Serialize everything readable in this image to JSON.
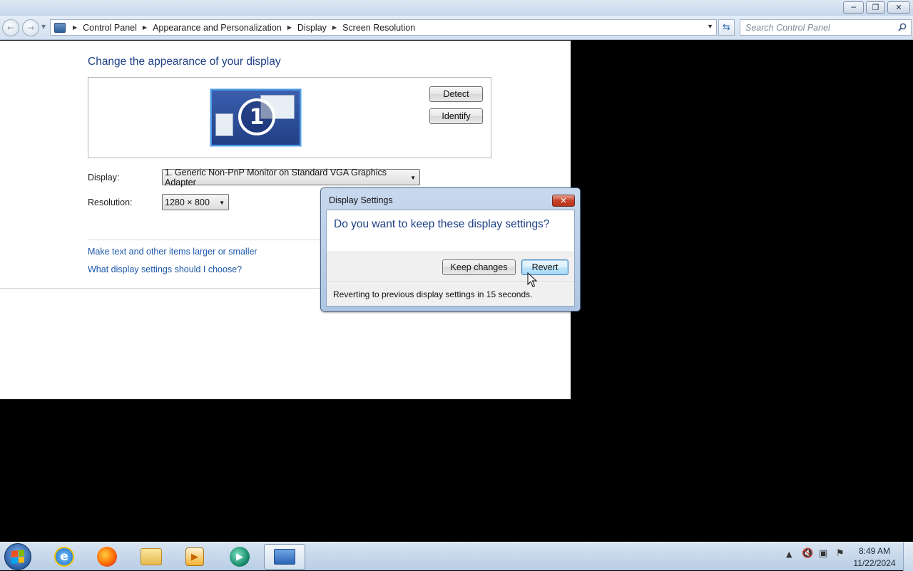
{
  "window": {
    "minimize_icon": "minimize-icon",
    "maximize_icon": "restore-icon",
    "close_icon": "close-icon"
  },
  "address": {
    "breadcrumbs": [
      "Control Panel",
      "Appearance and Personalization",
      "Display",
      "Screen Resolution"
    ],
    "search_placeholder": "Search Control Panel"
  },
  "main": {
    "title": "Change the appearance of your display",
    "monitor_number": "1",
    "detect_label": "Detect",
    "identify_label": "Identify",
    "display_label": "Display:",
    "display_value": "1. Generic Non-PnP Monitor on Standard VGA Graphics Adapter",
    "resolution_label": "Resolution:",
    "resolution_value": "1280 × 800",
    "link_text_size": "Make text and other items larger or smaller",
    "link_help": "What display settings should I choose?"
  },
  "dialog": {
    "title": "Display Settings",
    "question": "Do you want to keep these display settings?",
    "keep_label": "Keep changes",
    "revert_label": "Revert",
    "countdown_text": "Reverting to previous display settings in 15 seconds."
  },
  "taskbar": {
    "apps": [
      "internet-explorer-icon",
      "firefox-icon",
      "file-explorer-icon",
      "media-player-icon",
      "app-icon",
      "display-settings-icon"
    ],
    "time": "8:49 AM",
    "date": "11/22/2024"
  },
  "colors": {
    "heading_blue": "#1e3f86",
    "link_blue": "#1a57a8",
    "dialog_frame": "#aec6e3"
  }
}
